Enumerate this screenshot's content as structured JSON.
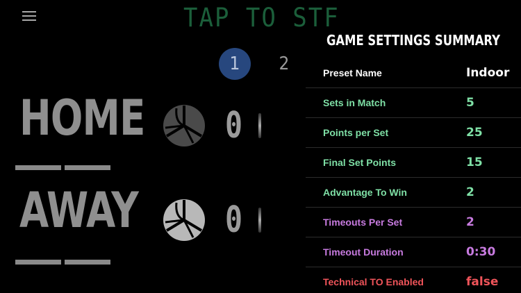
{
  "top_title": "TAP TO STF",
  "sets": {
    "tabs": [
      {
        "label": "1",
        "active": true
      },
      {
        "label": "2",
        "active": false
      }
    ]
  },
  "teams": {
    "home": {
      "name": "HOME",
      "score": "0"
    },
    "away": {
      "name": "AWAY",
      "score": "0"
    }
  },
  "summary": {
    "title": "GAME SETTINGS SUMMARY",
    "rows": [
      {
        "label": "Preset Name",
        "value": "Indoor",
        "color": "#ffffff"
      },
      {
        "label": "Sets in Match",
        "value": "5",
        "color": "#7fe0a6"
      },
      {
        "label": "Points per Set",
        "value": "25",
        "color": "#7fe0a6"
      },
      {
        "label": "Final Set Points",
        "value": "15",
        "color": "#7fe0a6"
      },
      {
        "label": "Advantage To Win",
        "value": "2",
        "color": "#7fe0a6"
      },
      {
        "label": "Timeouts Per Set",
        "value": "2",
        "color": "#c87be0"
      },
      {
        "label": "Timeout Duration",
        "value": "0:30",
        "color": "#c87be0"
      },
      {
        "label": "Technical TO Enabled",
        "value": "false",
        "color": "#f0545a"
      }
    ]
  },
  "icons": {
    "menu": "hamburger-menu-icon",
    "ball": "volleyball-icon"
  }
}
